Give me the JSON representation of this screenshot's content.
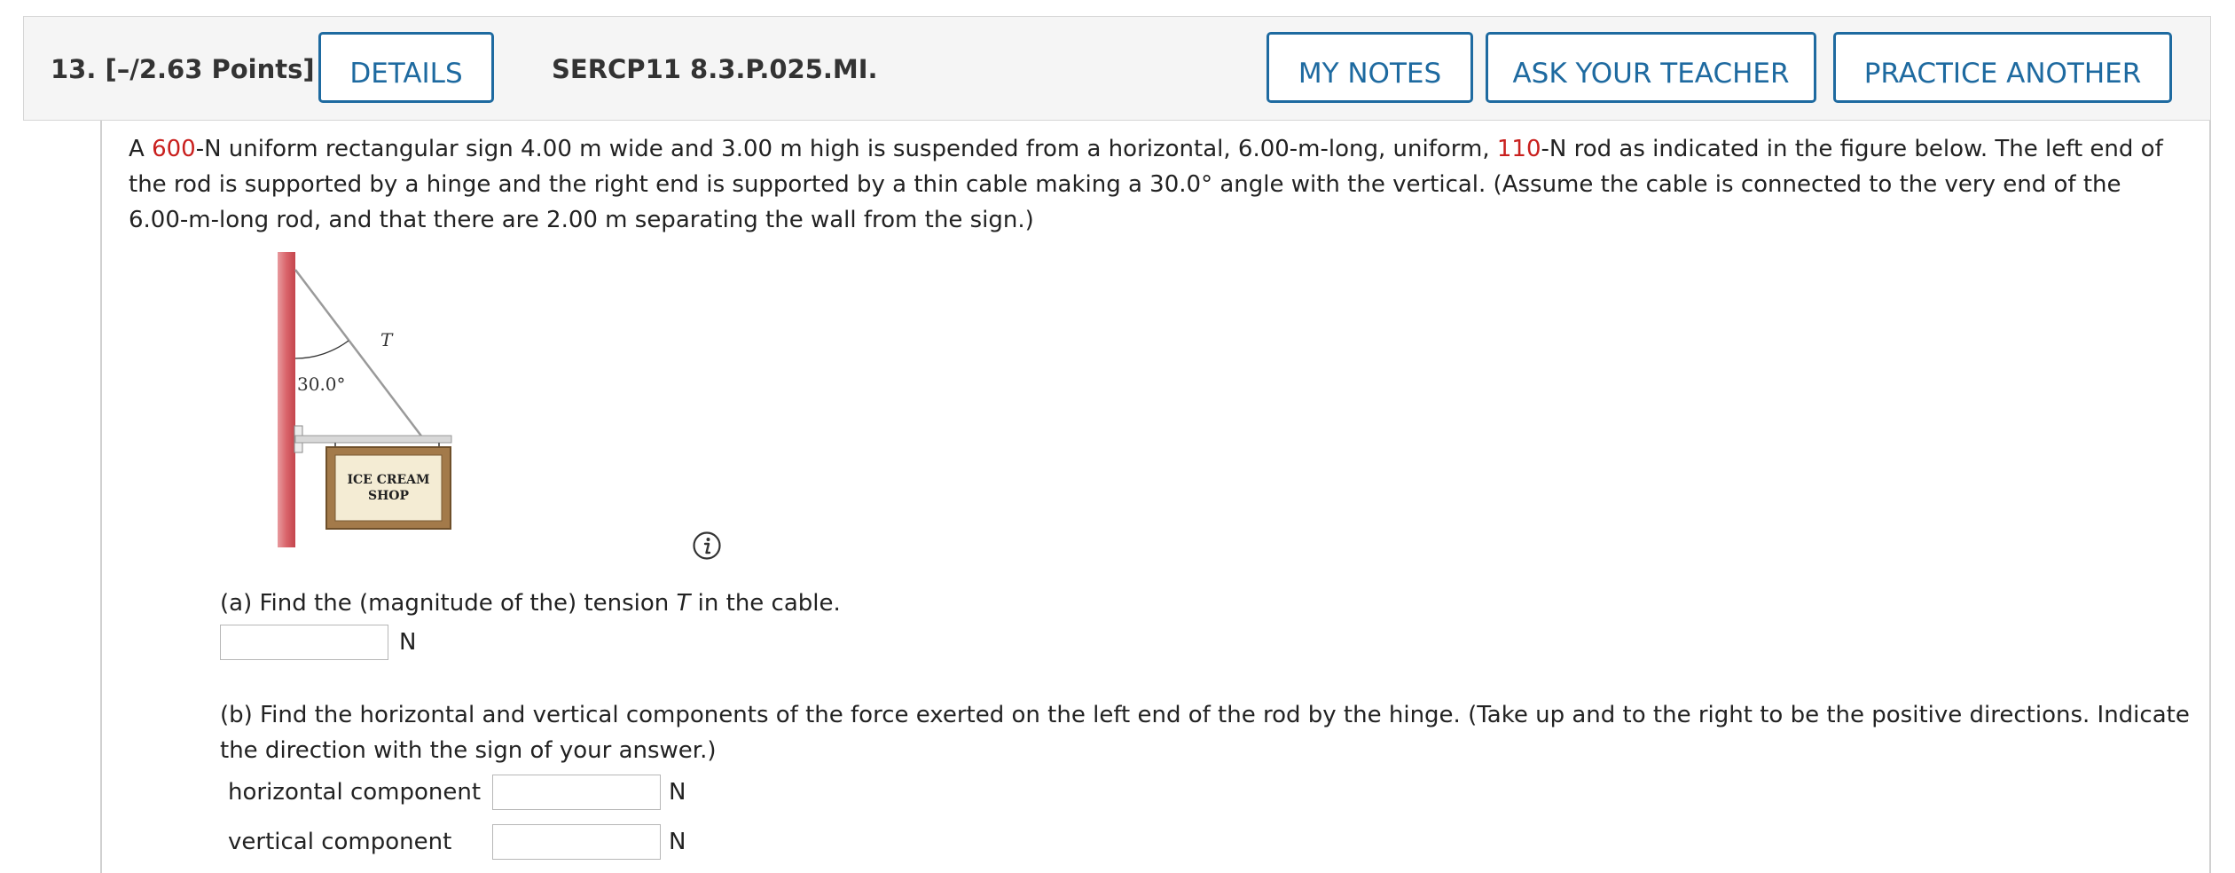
{
  "header": {
    "question_label": "13.  [–/2.63 Points]",
    "details_label": "DETAILS",
    "code": "SERCP11 8.3.P.025.MI.",
    "my_notes_label": "MY NOTES",
    "ask_teacher_label": "ASK YOUR TEACHER",
    "practice_label": "PRACTICE ANOTHER"
  },
  "problem": {
    "t1": "A ",
    "sign_weight": "600",
    "t2": "-N uniform rectangular sign 4.00 m wide and 3.00 m high is suspended from a horizontal, 6.00-m-long, uniform, ",
    "rod_weight": "110",
    "t3": "-N rod as indicated in the figure below. The left end of the rod is supported by a hinge and the right end is supported by a thin cable making a 30.0° angle with the vertical. (Assume the cable is connected to the very end of the 6.00-m-long rod, and that there are 2.00 m separating the wall from the sign.)"
  },
  "figure": {
    "tension_label": "T",
    "angle_label": "30.0°",
    "sign_line1": "ICE CREAM",
    "sign_line2": "SHOP"
  },
  "part_a": {
    "q1": "(a) Find the (magnitude of the) tension ",
    "q_var": "T",
    "q2": " in the cable.",
    "value": "",
    "unit": "N"
  },
  "part_b": {
    "question": "(b) Find the horizontal and vertical components of the force exerted on the left end of the rod by the hinge. (Take up and to the right to be the positive directions. Indicate the direction with the sign of your answer.)",
    "horizontal_label": "horizontal component",
    "horizontal_value": "",
    "horizontal_unit": "N",
    "vertical_label": "vertical component",
    "vertical_value": "",
    "vertical_unit": "N"
  },
  "colors": {
    "accent": "#1e6aa0",
    "highlight": "#c9201e",
    "wall": "#d9646a"
  },
  "icons": {
    "info": "info-icon"
  }
}
